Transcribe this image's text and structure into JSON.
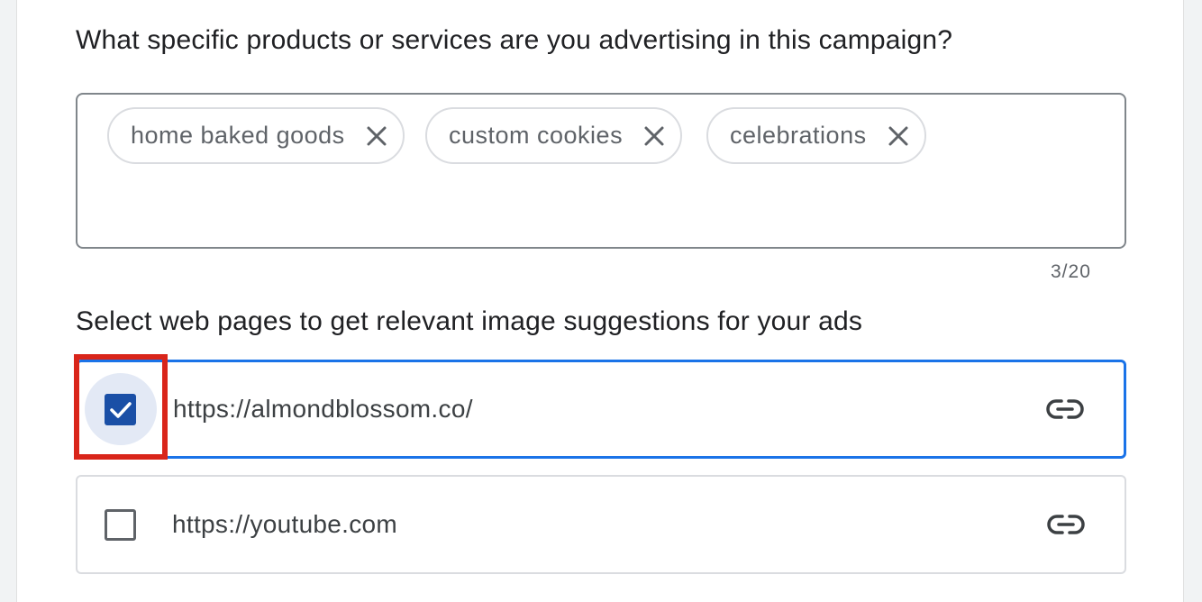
{
  "products_question": "What specific products or services are you advertising in this campaign?",
  "chips": [
    {
      "label": "home baked goods"
    },
    {
      "label": "custom cookies"
    },
    {
      "label": "celebrations"
    }
  ],
  "chip_counter": "3/20",
  "web_pages_label": "Select web pages to get relevant image suggestions for your ads",
  "web_pages": [
    {
      "url": "https://almondblossom.co/",
      "checked": true
    },
    {
      "url": "https://youtube.com",
      "checked": false
    }
  ],
  "colors": {
    "accent": "#1a73e8",
    "checkbox_fill": "#1a4fa6",
    "highlight": "#d9251a"
  }
}
